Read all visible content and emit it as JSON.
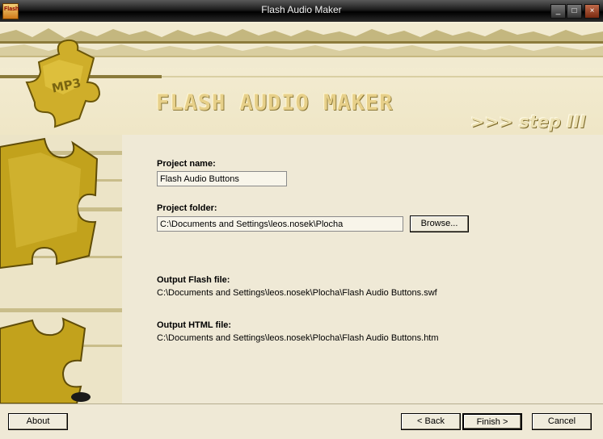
{
  "window": {
    "title": "Flash Audio Maker",
    "icon_label": "Flash",
    "controls": {
      "minimize": "_",
      "maximize": "□",
      "close": "×"
    }
  },
  "header": {
    "logo_text": "FLASH AUDIO MAKER",
    "step_text": ">>> step III",
    "puzzle_label": "MP3"
  },
  "form": {
    "project_name_label": "Project name:",
    "project_name_value": "Flash Audio Buttons",
    "project_folder_label": "Project folder:",
    "project_folder_value": "C:\\Documents and Settings\\leos.nosek\\Plocha",
    "browse_button": "Browse...",
    "output_flash_label": "Output Flash file:",
    "output_flash_value": "C:\\Documents and Settings\\leos.nosek\\Plocha\\Flash Audio Buttons.swf",
    "output_html_label": "Output HTML file:",
    "output_html_value": "C:\\Documents and Settings\\leos.nosek\\Plocha\\Flash Audio Buttons.htm"
  },
  "buttons": {
    "about": "About",
    "back": "< Back",
    "finish": "Finish >",
    "cancel": "Cancel"
  }
}
